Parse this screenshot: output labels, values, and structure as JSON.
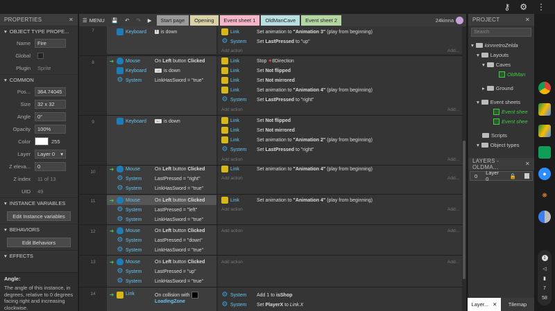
{
  "topbar": {
    "icons": [
      "key-icon",
      "settings-icon",
      "more-vert-icon"
    ]
  },
  "properties": {
    "title": "PROPERTIES",
    "object_type_header": "OBJECT TYPE PROPE...",
    "name_label": "Name",
    "name_value": "Fire",
    "global_label": "Global",
    "plugin_label": "Plugin",
    "plugin_value": "Sprite",
    "common_header": "COMMON",
    "pos_label": "Pos...",
    "pos_value": "364.74045",
    "size_label": "Size",
    "size_value": "32 x 32",
    "angle_label": "Angle",
    "angle_value": "0°",
    "opacity_label": "Opacity",
    "opacity_value": "100%",
    "color_label": "Color",
    "color_value": "255",
    "layer_label": "Layer",
    "layer_value": "Layer 0",
    "zelev_label": "Z eleva...",
    "zelev_value": "0",
    "zindex_label": "Z index",
    "zindex_value": "11 of 13",
    "uid_label": "UID",
    "uid_value": "49",
    "instvars_header": "INSTANCE VARIABLES",
    "edit_instvars": "Edit Instance variables",
    "behaviors_header": "BEHAVIORS",
    "edit_behaviors": "Edit Behaviors",
    "effects_header": "EFFECTS",
    "help_title": "Angle:",
    "help_text": "The angle of this instance, in degrees, relative to 0 degrees facing right and increasing clockwise."
  },
  "toolbar": {
    "menu_label": "MENU",
    "tabs": [
      {
        "label": "Start page",
        "bg": "#9a9a9a"
      },
      {
        "label": "Opening",
        "bg": "#d9d2a6"
      },
      {
        "label": "Event sheet 1",
        "bg": "#f4b6c8"
      },
      {
        "label": "OldManCave",
        "bg": "#b9dfe0"
      },
      {
        "label": "Event sheet 2",
        "bg": "#b3d7a2"
      }
    ],
    "user": "24kinna"
  },
  "events": {
    "e7": {
      "num": "7",
      "c1_obj": "Keyboard",
      "c1_key": "!",
      "c1_txt": "is down",
      "a1_obj": "Link",
      "a1_pre": "Set animation to ",
      "a1_b": "\"Animation 3\"",
      "a1_post": " (play from beginning)",
      "a2_obj": "System",
      "a2_pre": "Set ",
      "a2_b": "LastPressed",
      "a2_post": " to \"up\"",
      "add": "Add action",
      "add2": "Add..."
    },
    "e8": {
      "num": "8",
      "c1_obj": "Mouse",
      "c1_pre": "On ",
      "c1_b": "Left",
      "c1_mid": " button ",
      "c1_b2": "Clicked",
      "c2_obj": "Keyboard",
      "c2_key": "→",
      "c2_txt": "is down",
      "c3_obj": "System",
      "c3_txt": "LinkHasSword = \"true\"",
      "a1_obj": "Link",
      "a1_txt": "Stop",
      "a1_b": "8Direction",
      "a2_obj": "Link",
      "a2_pre": "Set ",
      "a2_b": "Not flipped",
      "a3_obj": "Link",
      "a3_pre": "Set ",
      "a3_b": "Not mirrored",
      "a4_obj": "Link",
      "a4_pre": "Set animation to ",
      "a4_b": "\"Animation 4\"",
      "a4_post": " (play from beginning)",
      "a5_obj": "System",
      "a5_pre": "Set ",
      "a5_b": "LastPressed",
      "a5_post": " to \"right\"",
      "add": "Add action",
      "add2": "Add..."
    },
    "e9": {
      "num": "9",
      "c1_obj": "Keyboard",
      "c1_key": "←",
      "c1_txt": "is down",
      "a1_obj": "Link",
      "a1_pre": "Set ",
      "a1_b": "Not flipped",
      "a2_obj": "Link",
      "a2_pre": "Set ",
      "a2_b": "Not mirrored",
      "a3_obj": "Link",
      "a3_pre": "Set animation to ",
      "a3_b": "\"Animation 2\"",
      "a3_post": " (play from beginning)",
      "a4_obj": "System",
      "a4_pre": "Set ",
      "a4_b": "LastPressed",
      "a4_post": " to \"right\"",
      "add": "Add action",
      "add2": "Add..."
    },
    "e10": {
      "num": "10",
      "c1_obj": "Mouse",
      "c1_pre": "On ",
      "c1_b": "Left",
      "c1_mid": " button ",
      "c1_b2": "Clicked",
      "c2_obj": "System",
      "c2_txt": "LastPressed = \"right\"",
      "c3_obj": "System",
      "c3_txt": "LinkHasSword = \"true\"",
      "a1_obj": "Link",
      "a1_pre": "Set animation to ",
      "a1_b": "\"Animation 4\"",
      "a1_post": " (play from beginning)",
      "add": "Add action",
      "add2": "Add..."
    },
    "e11": {
      "num": "11",
      "c1_obj": "Mouse",
      "c1_pre": "On ",
      "c1_b": "Left",
      "c1_mid": " button ",
      "c1_b2": "Clicked",
      "c2_obj": "System",
      "c2_txt": "LastPressed = \"left\"",
      "c3_obj": "System",
      "c3_txt": "LinkHasSword = \"true\"",
      "a1_obj": "Link",
      "a1_pre": "Set animation to ",
      "a1_b": "\"Animation 4\"",
      "a1_post": " (play from beginning)",
      "add": "Add action",
      "add2": "Add..."
    },
    "e12": {
      "num": "12",
      "c1_obj": "Mouse",
      "c1_pre": "On ",
      "c1_b": "Left",
      "c1_mid": " button ",
      "c1_b2": "Clicked",
      "c2_obj": "System",
      "c2_txt": "LastPressed = \"down\"",
      "c3_obj": "System",
      "c3_txt": "LinkHasSword = \"true\"",
      "add": "Add action",
      "add2": "Add..."
    },
    "e13": {
      "num": "13",
      "c1_obj": "Mouse",
      "c1_pre": "On ",
      "c1_b": "Left",
      "c1_mid": " button ",
      "c1_b2": "Clicked",
      "c2_obj": "System",
      "c2_txt": "LastPressed = \"up\"",
      "c3_obj": "System",
      "c3_txt": "LinkHasSword = \"true\"",
      "add": "Add action",
      "add2": "Add..."
    },
    "e14": {
      "num": "14",
      "c1_obj": "Link",
      "c1_txt": "On collision with",
      "c1_b": "LoadingZone",
      "a1_obj": "System",
      "a1_pre": "Add 1 to ",
      "a1_b": "isShop",
      "a2_obj": "System",
      "a2_pre": "Set ",
      "a2_b": "PlayerX",
      "a2_mid": " to ",
      "a2_i": "Link.X"
    }
  },
  "project": {
    "title": "PROJECT",
    "search_placeholder": "Search",
    "root": "kinnretroZelda",
    "layouts": "Layouts",
    "caves": "Caves",
    "oldman": "OldMan",
    "ground": "Ground",
    "event_sheets": "Event sheets",
    "es1": "Event shee",
    "es2": "Event shee",
    "scripts": "Scripts",
    "object_types": "Object types"
  },
  "layers": {
    "title": "LAYERS - OLDMA...",
    "row_num": "0",
    "row_name": "Layer 0"
  },
  "bottom_tabs": {
    "layers": "Layer...",
    "tilemap": "Tilemap"
  },
  "shelf": {
    "apps": [
      "chrome-icon",
      "google-drive-icon",
      "google-drive-icon",
      "google-classroom-icon",
      "zoom-icon",
      "butterfly-icon",
      "chrome-canary-icon"
    ],
    "notif_count": "1",
    "time_h": "7",
    "time_m": "58"
  }
}
